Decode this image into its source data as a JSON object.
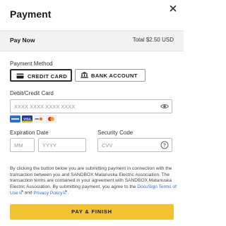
{
  "dialog": {
    "title": "Payment",
    "close_icon": "close-icon"
  },
  "summary": {
    "pay_now_label": "Pay Now",
    "total_text": "Total $2.50 USD"
  },
  "payment_method": {
    "label": "Payment Method",
    "options": [
      {
        "label": "CREDIT CARD",
        "icon": "credit-card-icon",
        "selected": true
      },
      {
        "label": "BANK ACCOUNT",
        "icon": "bank-icon",
        "selected": false
      }
    ]
  },
  "card": {
    "label": "Debit/Credit Card",
    "number_placeholder": "XXXX XXXX XXXX XXXX",
    "number_value": "",
    "visibility_icon": "eye-icon",
    "accepted_cards": [
      "amex",
      "visa",
      "discover",
      "mastercard"
    ]
  },
  "expiration": {
    "label": "Expiration Date",
    "month_placeholder": "MM",
    "year_placeholder": "YYYY"
  },
  "security": {
    "label": "Security Code",
    "placeholder": "CVV",
    "help_icon": "help-icon"
  },
  "disclaimer": {
    "text_1": "By clicking the button below you are submitting payment in connection with the transaction between you and SANDBOX Matanuska Electric Association. The transaction terms are contained in your agreement with SANDBOX Matanuska Electric Association. By submitting payment, you agree to the ",
    "terms_link": "DocuSign Terms of Use",
    "text_2": " and ",
    "privacy_link": "Privacy Policy",
    "text_3": "."
  },
  "submit": {
    "label": "PAY & FINISH"
  },
  "colors": {
    "accent_button": "#f2c232",
    "link": "#2b6fd6",
    "bar_background": "#f2f2f2"
  }
}
